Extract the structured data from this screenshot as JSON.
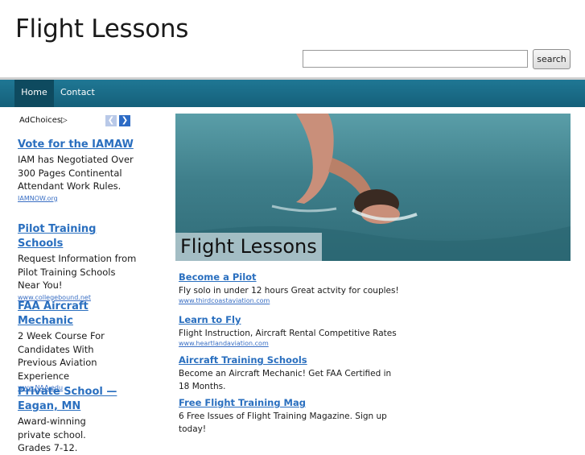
{
  "header": {
    "title": "Flight Lessons",
    "search_placeholder": "",
    "search_label": "search"
  },
  "nav": {
    "items": [
      "Home",
      "Contact"
    ]
  },
  "adbar": {
    "adchoices_label": "AdChoices",
    "prev_icon": "chevron-left-icon",
    "next_icon": "chevron-right-icon"
  },
  "sidebar_ads": [
    {
      "title": "Vote for the IAMAW",
      "desc": "IAM has Negotiated Over 300 Pages Continental Attendant Work Rules.",
      "url": "IAMNOW.org"
    },
    {
      "title": "Pilot Training Schools",
      "desc": "Request Information from Pilot Training Schools Near You!",
      "url": "www.collegebound.net"
    },
    {
      "title": "FAA Aircraft Mechanic",
      "desc": "2 Week Course For Candidates With Previous Aviation Experience",
      "url": "www.NAA.edu"
    },
    {
      "title": "Private School —Eagan, MN",
      "desc": "Award-winning private school. Grades 7-12.",
      "url": ""
    }
  ],
  "hero": {
    "label": "Flight Lessons"
  },
  "links": [
    {
      "title": "Become a Pilot",
      "desc": "Fly solo in under 12 hours Great actvity for couples!",
      "url": "www.thirdcoastaviation.com"
    },
    {
      "title": "Learn to Fly",
      "desc": "Flight Instruction, Aircraft Rental Competitive Rates",
      "url": "www.heartlandaviation.com"
    },
    {
      "title": "Aircraft Training Schools",
      "desc": "Become an Aircraft Mechanic! Get FAA Certified in 18 Months.",
      "url": ""
    },
    {
      "title": "Free Flight Training Mag",
      "desc": "6 Free Issues of Flight Training Magazine. Sign up today!",
      "url": ""
    }
  ]
}
